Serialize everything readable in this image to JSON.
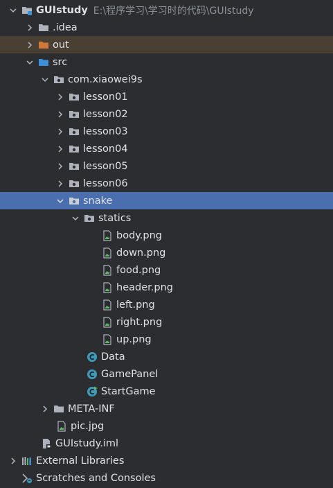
{
  "root": {
    "name": "GUIstudy",
    "path": "E:\\程序学习\\学习时的代码\\GUIstudy"
  },
  "nodes": [
    {
      "label": ".idea"
    },
    {
      "label": "out"
    },
    {
      "label": "src"
    },
    {
      "label": "com.xiaowei9s"
    },
    {
      "label": "lesson01"
    },
    {
      "label": "lesson02"
    },
    {
      "label": "lesson03"
    },
    {
      "label": "lesson04"
    },
    {
      "label": "lesson05"
    },
    {
      "label": "lesson06"
    },
    {
      "label": "snake"
    },
    {
      "label": "statics"
    },
    {
      "label": "body.png"
    },
    {
      "label": "down.png"
    },
    {
      "label": "food.png"
    },
    {
      "label": "header.png"
    },
    {
      "label": "left.png"
    },
    {
      "label": "right.png"
    },
    {
      "label": "up.png"
    },
    {
      "label": "Data"
    },
    {
      "label": "GamePanel"
    },
    {
      "label": "StartGame"
    },
    {
      "label": "META-INF"
    },
    {
      "label": "pic.jpg"
    },
    {
      "label": "GUIstudy.iml"
    },
    {
      "label": "External Libraries"
    },
    {
      "label": "Scratches and Consoles"
    }
  ],
  "colors": {
    "background": "#2b2d30",
    "selection": "#4b6eaf",
    "excluded_row": "#4a3f33",
    "folder": "#aeb3bb",
    "excluded_folder": "#d0773c",
    "source_folder": "#3d8fd6",
    "class_icon": "#3f9ab8"
  }
}
